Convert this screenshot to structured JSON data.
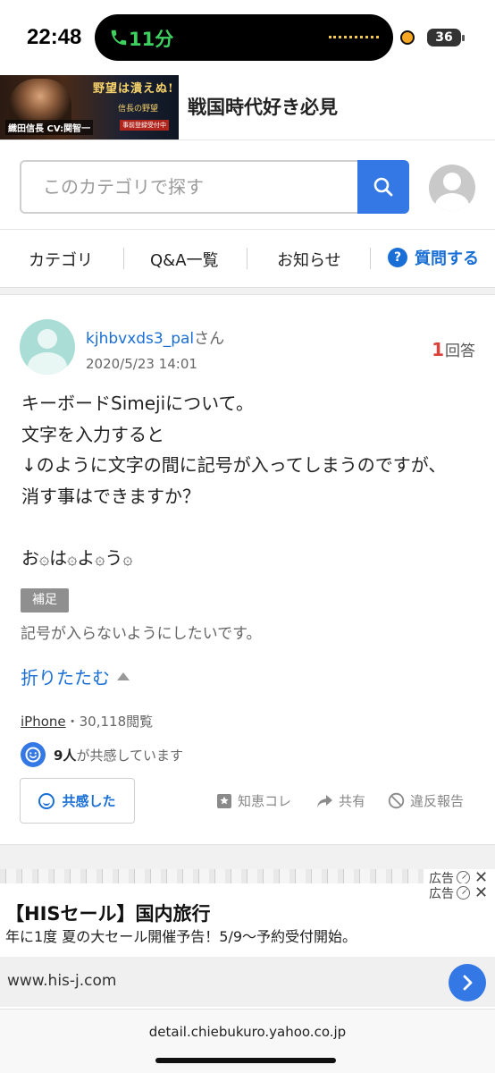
{
  "status": {
    "time": "22:48",
    "call_time": "11分",
    "battery": "36"
  },
  "banner": {
    "ad_headline": "野望は潰えぬ!",
    "ad_character_name": "織田信長",
    "ad_character_cv": "CV:関智一",
    "ad_game_title": "信長の野望",
    "ad_prereg": "事前登録受付中",
    "title": "戦国時代好き必見"
  },
  "search": {
    "placeholder": "このカテゴリで探す",
    "button_icon": "search-icon"
  },
  "nav": {
    "items": [
      "カテゴリ",
      "Q&A一覧",
      "お知らせ"
    ],
    "ask_label": "質問する"
  },
  "question": {
    "username": "kjhbvxds3_pal",
    "honorific": "さん",
    "date": "2020/5/23 14:01",
    "answer_count": "1",
    "answer_label": "回答",
    "body_lines": [
      "キーボードSimejiについて。",
      "文字を入力すると",
      "↓のように文字の間に記号が入ってしまうのですが、",
      "消す事はできますか？"
    ],
    "example_chars": [
      "お",
      "は",
      "よ",
      "う"
    ],
    "example_symbol": "۞",
    "supplement_badge": "補足",
    "supplement_text": "記号が入らないようにしたいです。",
    "collapse_label": "折りたたむ",
    "device": "iPhone",
    "views": "・30,118閲覧",
    "empathy_count": "9人",
    "empathy_suffix": "が共感しています",
    "empathy_button": "共感した",
    "actions": {
      "chiebukuro": "知恵コレ",
      "share": "共有",
      "report": "違反報告"
    }
  },
  "ad": {
    "label": "広告",
    "title": "【HISセール】国内旅行",
    "description": "年に1度 夏の大セール開催予告！5/9〜予約受付開始。",
    "url": "www.his-j.com"
  },
  "browser": {
    "url": "detail.chiebukuro.yahoo.co.jp"
  }
}
